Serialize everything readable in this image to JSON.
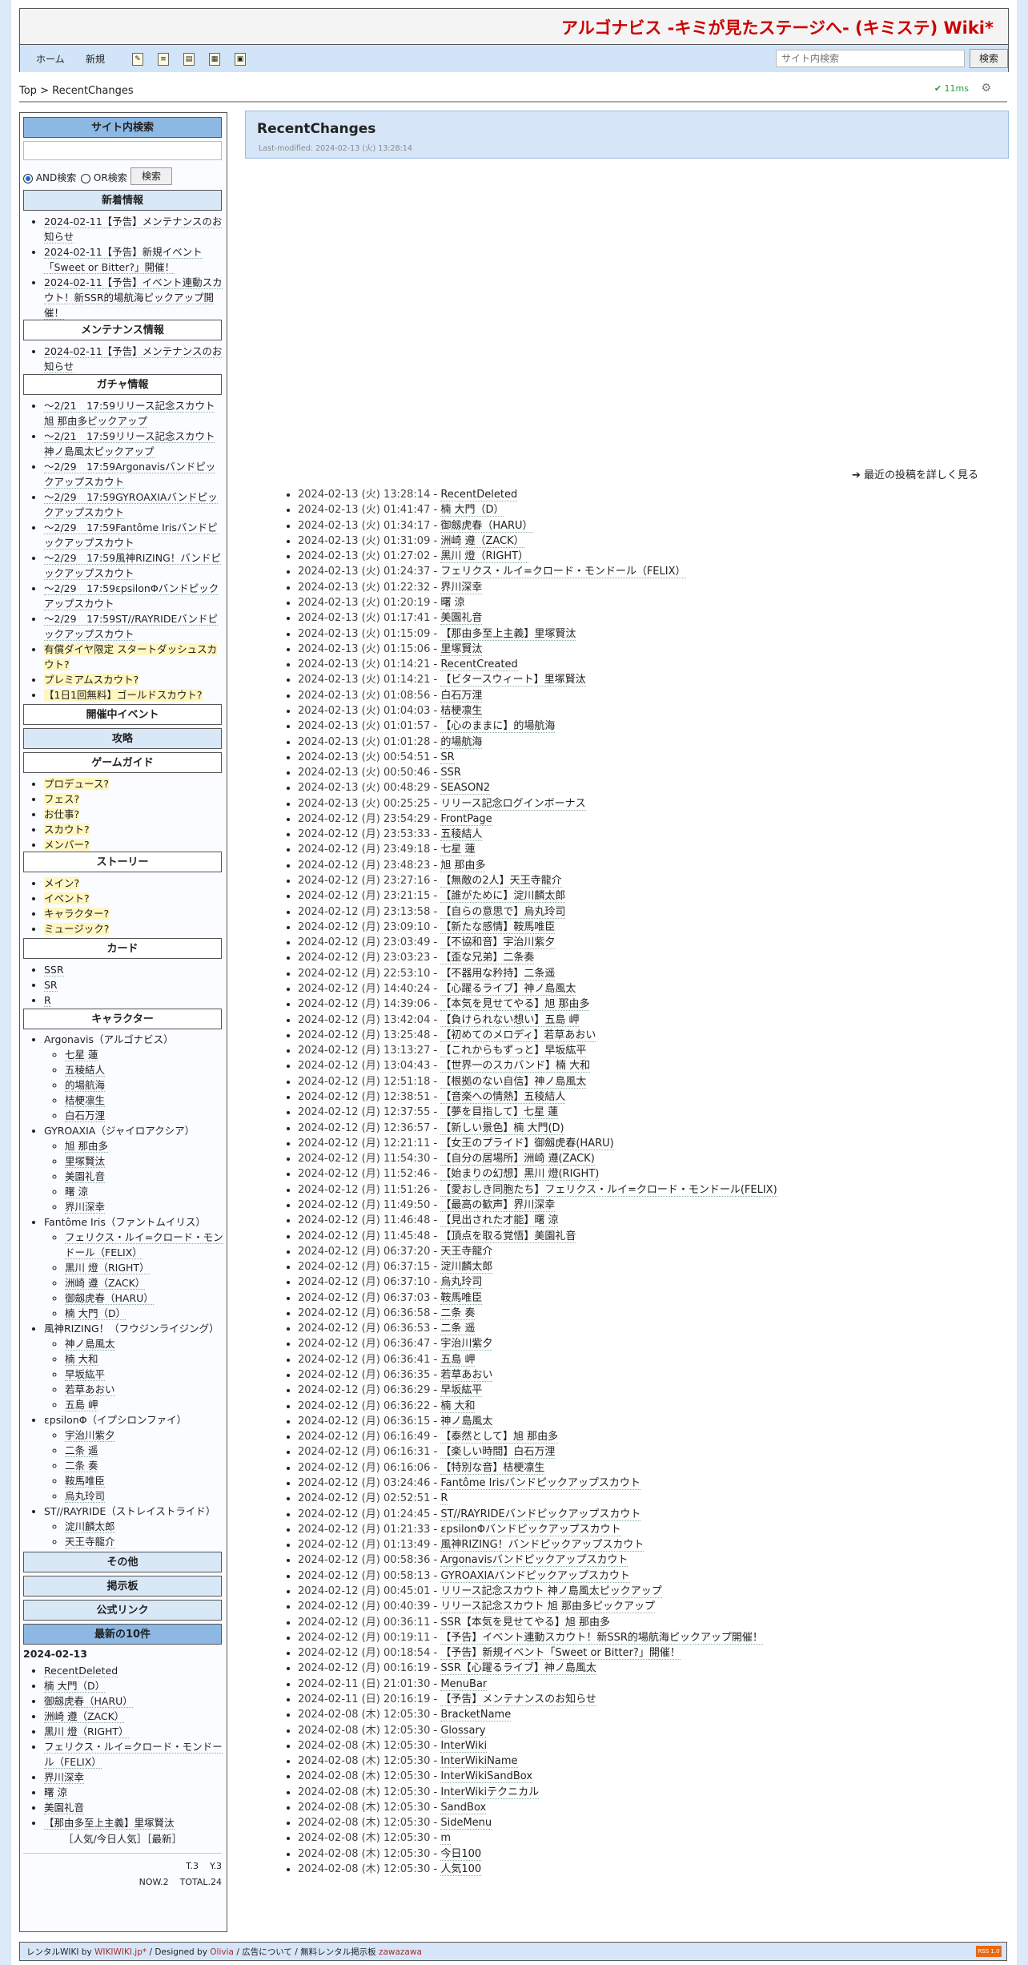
{
  "header": {
    "site_title": "アルゴナビス -キミが見たステージへ- (キミステ) Wiki*",
    "nav": {
      "home": "ホーム",
      "new": "新規"
    },
    "search_placeholder": "サイト内検索",
    "search_button": "検索"
  },
  "breadcrumb": {
    "top": "Top",
    "sep": ">",
    "current": "RecentChanges"
  },
  "perf": "11ms",
  "sidebar": {
    "site_search": {
      "heading": "サイト内検索",
      "and_label": "AND検索",
      "or_label": "OR検索",
      "button": "検索"
    },
    "news": {
      "heading": "新着情報",
      "items": [
        "2024-02-11【予告】メンテナンスのお知らせ",
        "2024-02-11【予告】新規イベント「Sweet or Bitter?」開催！",
        "2024-02-11【予告】イベント連動スカウト！新SSR的場航海ピックアップ開催！"
      ]
    },
    "maintenance": {
      "heading": "メンテナンス情報",
      "items": [
        "2024-02-11【予告】メンテナンスのお知らせ"
      ]
    },
    "gacha": {
      "heading": "ガチャ情報",
      "items": [
        "～2/21　17:59リリース記念スカウト 旭 那由多ピックアップ",
        "～2/21　17:59リリース記念スカウト 神ノ島風太ピックアップ",
        "～2/29　17:59Argonavisバンドピックアップスカウト",
        "～2/29　17:59GYROAXIAバンドピックアップスカウト",
        "～2/29　17:59Fantôme Irisバンドピックアップスカウト",
        "～2/29　17:59風神RIZING！バンドピックアップスカウト",
        "～2/29　17:59εpsilonΦバンドピックアップスカウト",
        "～2/29　17:59ST//RAYRIDEバンドピックアップスカウト"
      ],
      "highlight_items": [
        "有償ダイヤ限定 スタートダッシュスカウト?",
        "プレミアムスカウト?",
        "【1日1回無料】ゴールドスカウト?"
      ]
    },
    "event_heading": "開催中イベント",
    "strategy_heading": "攻略",
    "guide": {
      "heading": "ゲームガイド",
      "items": [
        "プロデュース?",
        "フェス?",
        "お仕事?",
        "スカウト?",
        "メンバー?"
      ]
    },
    "story": {
      "heading": "ストーリー",
      "items": [
        "メイン?",
        "イベント?",
        "キャラクター?",
        "ミュージック?"
      ]
    },
    "card": {
      "heading": "カード",
      "items": [
        "SSR",
        "SR",
        "R"
      ]
    },
    "character": {
      "heading": "キャラクター",
      "groups": [
        {
          "name": "Argonavis（アルゴナビス）",
          "members": [
            "七星 蓮",
            "五稜結人",
            "的場航海",
            "桔梗凛生",
            "白石万浬"
          ]
        },
        {
          "name": "GYROAXIA（ジャイロアクシア）",
          "members": [
            "旭 那由多",
            "里塚賢汰",
            "美園礼音",
            "曙 涼",
            "界川深幸"
          ]
        },
        {
          "name": "Fantôme Iris（ファントムイリス）",
          "members": [
            "フェリクス・ルイ=クロード・モンドール（FELIX）",
            "黒川 燈（RIGHT）",
            "洲崎 遵（ZACK）",
            "御劔虎春（HARU）",
            "楠 大門（D）"
          ]
        },
        {
          "name": "風神RIZING！（フウジンライジング）",
          "members": [
            "神ノ島風太",
            "楠 大和",
            "早坂紘平",
            "若草あおい",
            "五島 岬"
          ]
        },
        {
          "name": "εpsilonΦ（イプシロンファイ）",
          "members": [
            "宇治川紫夕",
            "二条 遥",
            "二条 奏",
            "鞍馬唯臣",
            "烏丸玲司"
          ]
        },
        {
          "name": "ST//RAYRIDE（ストレイストライド）",
          "members": [
            "淀川麟太郎",
            "天王寺龍介"
          ]
        }
      ]
    },
    "other_heading": "その他",
    "bbs_heading": "掲示板",
    "official_heading": "公式リンク",
    "latest": {
      "heading": "最新の10件",
      "date": "2024-02-13",
      "items": [
        "RecentDeleted",
        "楠 大門（D）",
        "御劔虎春（HARU）",
        "洲崎 遵（ZACK）",
        "黒川 燈（RIGHT）",
        "フェリクス・ルイ=クロード・モンドール（FELIX）",
        "界川深幸",
        "曙 涼",
        "美園礼音",
        "【那由多至上主義】里塚賢汰"
      ],
      "popular_links": "［人気/今日人気］［最新］"
    },
    "counter": {
      "t": "T.3",
      "y": "Y.3",
      "now": "NOW.2",
      "total": "TOTAL.24"
    }
  },
  "main": {
    "title": "RecentChanges",
    "last_modified": "Last-modified: 2024-02-13 (火) 13:28:14",
    "more_link": "最近の投稿を詳しく見る",
    "changes": [
      [
        "2024-02-13 (火) 13:28:14",
        "RecentDeleted"
      ],
      [
        "2024-02-13 (火) 01:41:47",
        "楠 大門（D）"
      ],
      [
        "2024-02-13 (火) 01:34:17",
        "御劔虎春（HARU）"
      ],
      [
        "2024-02-13 (火) 01:31:09",
        "洲崎 遵（ZACK）"
      ],
      [
        "2024-02-13 (火) 01:27:02",
        "黒川 燈（RIGHT）"
      ],
      [
        "2024-02-13 (火) 01:24:37",
        "フェリクス・ルイ=クロード・モンドール（FELIX）"
      ],
      [
        "2024-02-13 (火) 01:22:32",
        "界川深幸"
      ],
      [
        "2024-02-13 (火) 01:20:19",
        "曙 涼"
      ],
      [
        "2024-02-13 (火) 01:17:41",
        "美園礼音"
      ],
      [
        "2024-02-13 (火) 01:15:09",
        "【那由多至上主義】里塚賢汰"
      ],
      [
        "2024-02-13 (火) 01:15:06",
        "里塚賢汰"
      ],
      [
        "2024-02-13 (火) 01:14:21",
        "RecentCreated"
      ],
      [
        "2024-02-13 (火) 01:14:21",
        "【ビタースウィート】里塚賢汰"
      ],
      [
        "2024-02-13 (火) 01:08:56",
        "白石万浬"
      ],
      [
        "2024-02-13 (火) 01:04:03",
        "桔梗凛生"
      ],
      [
        "2024-02-13 (火) 01:01:57",
        "【心のままに】的場航海"
      ],
      [
        "2024-02-13 (火) 01:01:28",
        "的場航海"
      ],
      [
        "2024-02-13 (火) 00:54:51",
        "SR"
      ],
      [
        "2024-02-13 (火) 00:50:46",
        "SSR"
      ],
      [
        "2024-02-13 (火) 00:48:29",
        "SEASON2"
      ],
      [
        "2024-02-13 (火) 00:25:25",
        "リリース記念ログインボーナス"
      ],
      [
        "2024-02-12 (月) 23:54:29",
        "FrontPage"
      ],
      [
        "2024-02-12 (月) 23:53:33",
        "五稜結人"
      ],
      [
        "2024-02-12 (月) 23:49:18",
        "七星 蓮"
      ],
      [
        "2024-02-12 (月) 23:48:23",
        "旭 那由多"
      ],
      [
        "2024-02-12 (月) 23:27:16",
        "【無敵の2人】天王寺龍介"
      ],
      [
        "2024-02-12 (月) 23:21:15",
        "【誰がために】淀川麟太郎"
      ],
      [
        "2024-02-12 (月) 23:13:58",
        "【自らの意思で】烏丸玲司"
      ],
      [
        "2024-02-12 (月) 23:09:10",
        "【新たな感情】鞍馬唯臣"
      ],
      [
        "2024-02-12 (月) 23:03:49",
        "【不協和音】宇治川紫夕"
      ],
      [
        "2024-02-12 (月) 23:03:23",
        "【歪な兄弟】二条奏"
      ],
      [
        "2024-02-12 (月) 22:53:10",
        "【不器用な矜持】二条遥"
      ],
      [
        "2024-02-12 (月) 14:40:24",
        "【心躍るライブ】神ノ島風太"
      ],
      [
        "2024-02-12 (月) 14:39:06",
        "【本気を見せてやる】旭 那由多"
      ],
      [
        "2024-02-12 (月) 13:42:04",
        "【負けられない想い】五島 岬"
      ],
      [
        "2024-02-12 (月) 13:25:48",
        "【初めてのメロディ】若草あおい"
      ],
      [
        "2024-02-12 (月) 13:13:27",
        "【これからもずっと】早坂紘平"
      ],
      [
        "2024-02-12 (月) 13:04:43",
        "【世界一のスカバンド】楠 大和"
      ],
      [
        "2024-02-12 (月) 12:51:18",
        "【根拠のない自信】神ノ島風太"
      ],
      [
        "2024-02-12 (月) 12:38:51",
        "【音楽への情熱】五稜結人"
      ],
      [
        "2024-02-12 (月) 12:37:55",
        "【夢を目指して】七星 蓮"
      ],
      [
        "2024-02-12 (月) 12:36:57",
        "【新しい景色】楠 大門(D)"
      ],
      [
        "2024-02-12 (月) 12:21:11",
        "【女王のプライド】御劔虎春(HARU)"
      ],
      [
        "2024-02-12 (月) 11:54:30",
        "【自分の居場所】洲崎 遵(ZACK)"
      ],
      [
        "2024-02-12 (月) 11:52:46",
        "【始まりの幻想】黒川 燈(RIGHT)"
      ],
      [
        "2024-02-12 (月) 11:51:26",
        "【愛おしき同胞たち】フェリクス・ルイ=クロード・モンドール(FELIX)"
      ],
      [
        "2024-02-12 (月) 11:49:50",
        "【最高の歓声】界川深幸"
      ],
      [
        "2024-02-12 (月) 11:46:48",
        "【見出された才能】曙 涼"
      ],
      [
        "2024-02-12 (月) 11:45:48",
        "【頂点を取る覚悟】美園礼音"
      ],
      [
        "2024-02-12 (月) 06:37:20",
        "天王寺龍介"
      ],
      [
        "2024-02-12 (月) 06:37:15",
        "淀川麟太郎"
      ],
      [
        "2024-02-12 (月) 06:37:10",
        "烏丸玲司"
      ],
      [
        "2024-02-12 (月) 06:37:03",
        "鞍馬唯臣"
      ],
      [
        "2024-02-12 (月) 06:36:58",
        "二条 奏"
      ],
      [
        "2024-02-12 (月) 06:36:53",
        "二条 遥"
      ],
      [
        "2024-02-12 (月) 06:36:47",
        "宇治川紫夕"
      ],
      [
        "2024-02-12 (月) 06:36:41",
        "五島 岬"
      ],
      [
        "2024-02-12 (月) 06:36:35",
        "若草あおい"
      ],
      [
        "2024-02-12 (月) 06:36:29",
        "早坂紘平"
      ],
      [
        "2024-02-12 (月) 06:36:22",
        "楠 大和"
      ],
      [
        "2024-02-12 (月) 06:36:15",
        "神ノ島風太"
      ],
      [
        "2024-02-12 (月) 06:16:49",
        "【泰然として】旭 那由多"
      ],
      [
        "2024-02-12 (月) 06:16:31",
        "【楽しい時間】白石万浬"
      ],
      [
        "2024-02-12 (月) 06:16:06",
        "【特別な音】桔梗凛生"
      ],
      [
        "2024-02-12 (月) 03:24:46",
        "Fantôme Irisバンドピックアップスカウト"
      ],
      [
        "2024-02-12 (月) 02:52:51",
        "R"
      ],
      [
        "2024-02-12 (月) 01:24:45",
        "ST//RAYRIDEバンドピックアップスカウト"
      ],
      [
        "2024-02-12 (月) 01:21:33",
        "εpsilonΦバンドピックアップスカウト"
      ],
      [
        "2024-02-12 (月) 01:13:49",
        "風神RIZING！バンドピックアップスカウト"
      ],
      [
        "2024-02-12 (月) 00:58:36",
        "Argonavisバンドピックアップスカウト"
      ],
      [
        "2024-02-12 (月) 00:58:13",
        "GYROAXIAバンドピックアップスカウト"
      ],
      [
        "2024-02-12 (月) 00:45:01",
        "リリース記念スカウト 神ノ島風太ピックアップ"
      ],
      [
        "2024-02-12 (月) 00:40:39",
        "リリース記念スカウト 旭 那由多ピックアップ"
      ],
      [
        "2024-02-12 (月) 00:36:11",
        "SSR【本気を見せてやる】旭 那由多"
      ],
      [
        "2024-02-12 (月) 00:19:11",
        "【予告】イベント連動スカウト！新SSR的場航海ピックアップ開催！"
      ],
      [
        "2024-02-12 (月) 00:18:54",
        "【予告】新規イベント「Sweet or Bitter?」開催！"
      ],
      [
        "2024-02-12 (月) 00:16:19",
        "SSR【心躍るライブ】神ノ島風太"
      ],
      [
        "2024-02-11 (日) 21:01:30",
        "MenuBar"
      ],
      [
        "2024-02-11 (日) 20:16:19",
        "【予告】メンテナンスのお知らせ"
      ],
      [
        "2024-02-08 (木) 12:05:30",
        "BracketName"
      ],
      [
        "2024-02-08 (木) 12:05:30",
        "Glossary"
      ],
      [
        "2024-02-08 (木) 12:05:30",
        "InterWiki"
      ],
      [
        "2024-02-08 (木) 12:05:30",
        "InterWikiName"
      ],
      [
        "2024-02-08 (木) 12:05:30",
        "InterWikiSandBox"
      ],
      [
        "2024-02-08 (木) 12:05:30",
        "InterWikiテクニカル"
      ],
      [
        "2024-02-08 (木) 12:05:30",
        "SandBox"
      ],
      [
        "2024-02-08 (木) 12:05:30",
        "SideMenu"
      ],
      [
        "2024-02-08 (木) 12:05:30",
        "m"
      ],
      [
        "2024-02-08 (木) 12:05:30",
        "今日100"
      ],
      [
        "2024-02-08 (木) 12:05:30",
        "人気100"
      ]
    ]
  },
  "footer": {
    "rental": "レンタルWIKI by",
    "wikiwiki": "WIKIWIKI.jp*",
    "designed": "/ Designed by",
    "designer": "Olivia",
    "ad": "/ 広告について /",
    "bbs": "無料レンタル掲示板",
    "bbs_link": "zawazawa",
    "rss": "RSS 1.0"
  }
}
